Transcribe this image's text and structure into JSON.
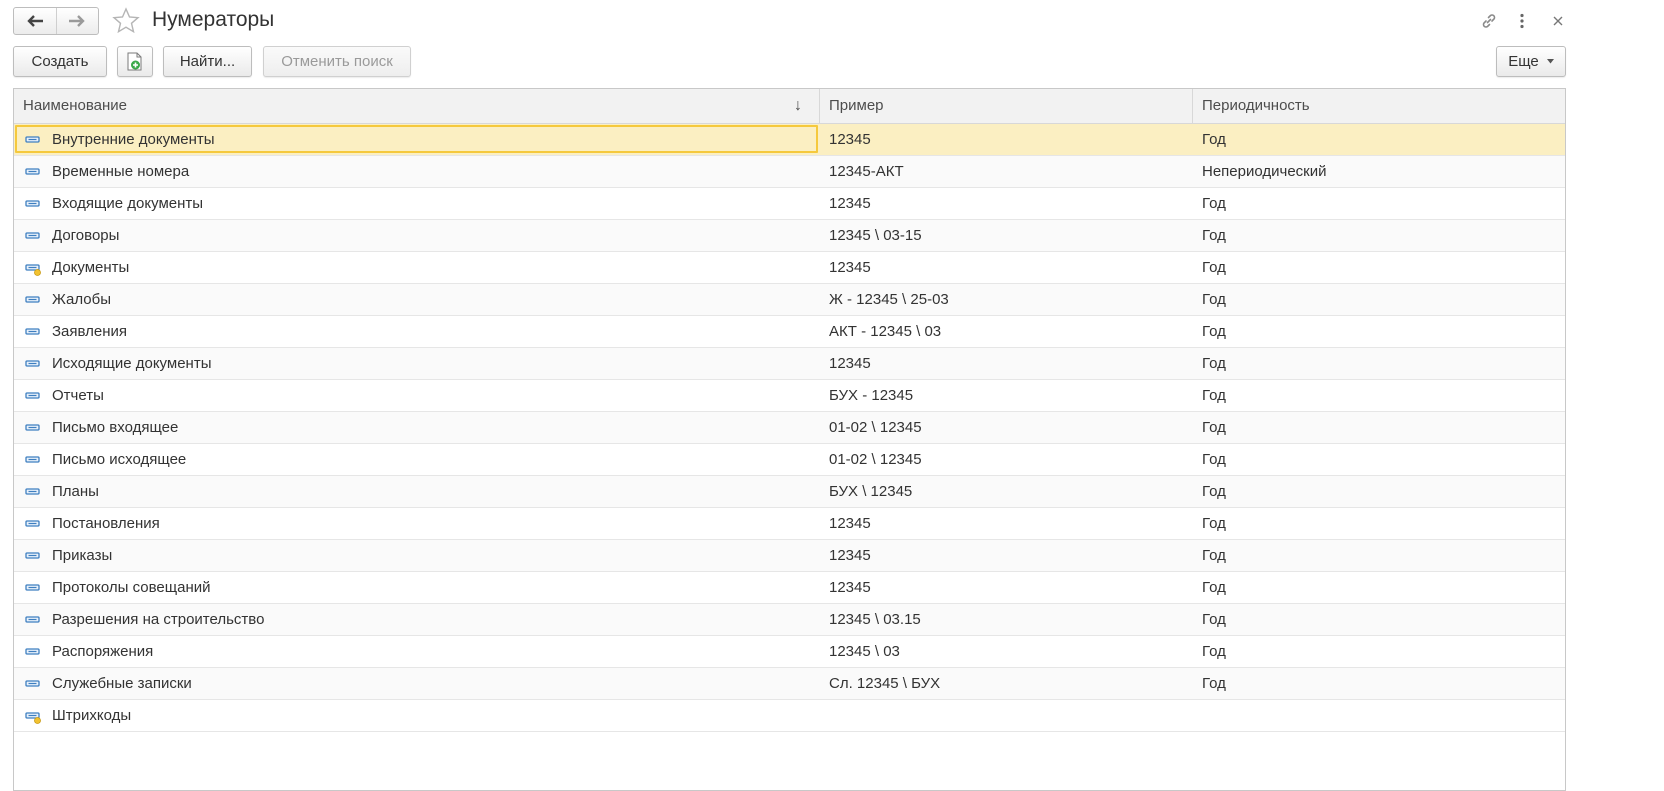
{
  "window": {
    "title": "Нумераторы"
  },
  "toolbar": {
    "create_label": "Создать",
    "find_label": "Найти...",
    "cancel_search_label": "Отменить поиск",
    "more_label": "Еще"
  },
  "table": {
    "columns": [
      "Наименование",
      "Пример",
      "Периодичность"
    ],
    "sort_indicator": "↓",
    "rows": [
      {
        "name": "Внутренние документы",
        "example": "12345",
        "period": "Год",
        "icon": "element-icon",
        "selected": true
      },
      {
        "name": "Временные номера",
        "example": "12345-АКТ",
        "period": "Непериодический",
        "icon": "element-icon"
      },
      {
        "name": "Входящие документы",
        "example": "12345",
        "period": "Год",
        "icon": "element-icon"
      },
      {
        "name": "Договоры",
        "example": "12345 \\ 03-15",
        "period": "Год",
        "icon": "element-icon"
      },
      {
        "name": "Документы",
        "example": "12345",
        "period": "Год",
        "icon": "predefined-element-icon"
      },
      {
        "name": "Жалобы",
        "example": "Ж - 12345 \\ 25-03",
        "period": "Год",
        "icon": "element-icon"
      },
      {
        "name": "Заявления",
        "example": "АКТ - 12345 \\ 03",
        "period": "Год",
        "icon": "element-icon"
      },
      {
        "name": "Исходящие документы",
        "example": "12345",
        "period": "Год",
        "icon": "element-icon"
      },
      {
        "name": "Отчеты",
        "example": "БУХ - 12345",
        "period": "Год",
        "icon": "element-icon"
      },
      {
        "name": "Письмо входящее",
        "example": "01-02 \\ 12345",
        "period": "Год",
        "icon": "element-icon"
      },
      {
        "name": "Письмо исходящее",
        "example": "01-02 \\ 12345",
        "period": "Год",
        "icon": "element-icon"
      },
      {
        "name": "Планы",
        "example": "БУХ \\ 12345",
        "period": "Год",
        "icon": "element-icon"
      },
      {
        "name": "Постановления",
        "example": "12345",
        "period": "Год",
        "icon": "element-icon"
      },
      {
        "name": "Приказы",
        "example": "12345",
        "period": "Год",
        "icon": "element-icon"
      },
      {
        "name": "Протоколы совещаний",
        "example": "12345",
        "period": "Год",
        "icon": "element-icon"
      },
      {
        "name": "Разрешения на строительство",
        "example": "12345 \\ 03.15",
        "period": "Год",
        "icon": "element-icon"
      },
      {
        "name": "Распоряжения",
        "example": "12345 \\ 03",
        "period": "Год",
        "icon": "element-icon"
      },
      {
        "name": "Служебные записки",
        "example": "Сл. 12345 \\ БУХ",
        "period": "Год",
        "icon": "element-icon"
      },
      {
        "name": "Штрихкоды",
        "example": "",
        "period": "",
        "icon": "predefined-element-icon"
      }
    ]
  },
  "colors": {
    "selected_row": "#fbefc2",
    "selection_border": "#f5c93d",
    "element_icon": "#3f7fc0",
    "predefined_marker": "#f2c230"
  }
}
